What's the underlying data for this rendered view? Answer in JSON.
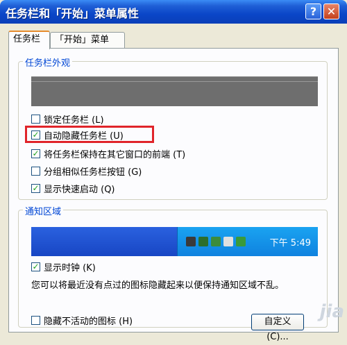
{
  "window": {
    "title": "任务栏和「开始」菜单属性",
    "help_label": "?",
    "close_label": "✕"
  },
  "tabs": [
    {
      "label": "任务栏",
      "active": true
    },
    {
      "label": "「开始」菜单",
      "active": false
    }
  ],
  "appearance": {
    "title": "任务栏外观",
    "options": [
      {
        "label": "锁定任务栏 (L)",
        "checked": false
      },
      {
        "label": "自动隐藏任务栏 (U)",
        "checked": true
      },
      {
        "label": "将任务栏保持在其它窗口的前端 (T)",
        "checked": true
      },
      {
        "label": "分组相似任务栏按钮 (G)",
        "checked": false
      },
      {
        "label": "显示快速启动 (Q)",
        "checked": true
      }
    ]
  },
  "notify": {
    "title": "通知区域",
    "clock_text": "下午 5:49",
    "options": [
      {
        "label": "显示时钟 (K)",
        "checked": true
      },
      {
        "label": "隐藏不活动的图标 (H)",
        "checked": false
      }
    ],
    "info_text": "您可以将最近没有点过的图标隐藏起来以便保持通知区域不乱。",
    "customize_label": "自定义 (C)..."
  },
  "watermark": "jia",
  "colors": {
    "accent": "#0046d5",
    "highlight": "#e0242a",
    "check": "#21a121"
  }
}
